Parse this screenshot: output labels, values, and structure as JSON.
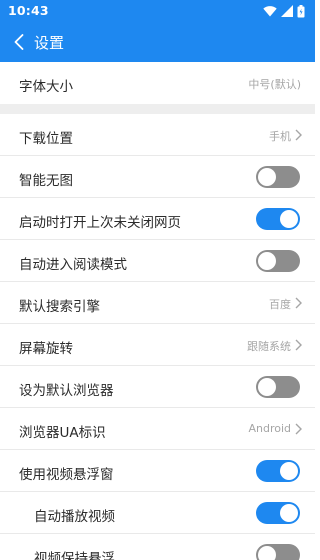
{
  "status_bar": {
    "time": "10:43"
  },
  "app_bar": {
    "title": "设置"
  },
  "font_size": {
    "label": "字体大小",
    "value": "中号(默认)"
  },
  "settings": [
    {
      "label": "下载位置",
      "value": "手机"
    },
    {
      "label": "智能无图",
      "toggle": false
    },
    {
      "label": "启动时打开上次未关闭网页",
      "toggle": true
    },
    {
      "label": "自动进入阅读模式",
      "toggle": false
    },
    {
      "label": "默认搜索引擎",
      "value": "百度"
    },
    {
      "label": "屏幕旋转",
      "value": "跟随系统"
    },
    {
      "label": "设为默认浏览器",
      "toggle": false
    },
    {
      "label": "浏览器UA标识",
      "value": "Android"
    },
    {
      "label": "使用视频悬浮窗",
      "toggle": true
    },
    {
      "label": "自动播放视频",
      "toggle": true
    },
    {
      "label": "视频保持悬浮",
      "toggle": false
    }
  ],
  "colors": {
    "accent": "#1e88f0",
    "toggle_off": "#8d8d8d",
    "divider": "#eeeeee"
  },
  "icons": [
    "wifi-icon",
    "signal-icon",
    "battery-icon",
    "back-arrow-icon",
    "chevron-right-icon"
  ]
}
